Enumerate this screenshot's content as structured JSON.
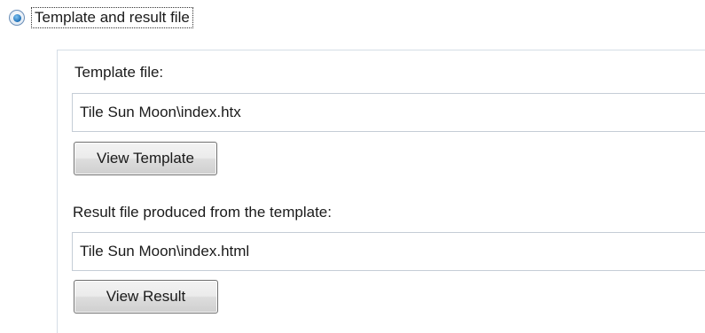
{
  "mode_option": {
    "label": "Template and result file",
    "selected": true
  },
  "template": {
    "label": "Template file:",
    "value": "Tile Sun Moon\\index.htx",
    "button_label": "View Template"
  },
  "result": {
    "label": "Result file produced from the template:",
    "value": "Tile Sun Moon\\index.html",
    "button_label": "View Result"
  }
}
